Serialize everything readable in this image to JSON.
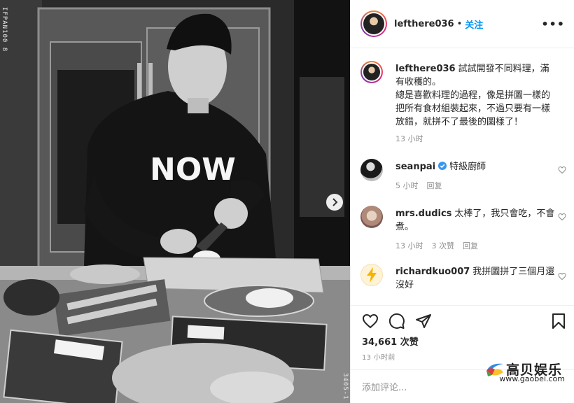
{
  "film": {
    "left_code": "IFPAN100   8",
    "right_code": "3405-1"
  },
  "shirt_text": "NOW",
  "post": {
    "username": "lefthere036",
    "separator": "•",
    "follow_label": "关注",
    "more_icon": "more-horizontal-icon"
  },
  "caption": {
    "username": "lefthere036",
    "text": "試試開發不同料理，滿有收穫的。",
    "line2": "總是喜歡料理的過程，像是拼圖一樣的把所有食材組裝起來，不過只要有一樣放錯，就拼不了最後的圖樣了！",
    "time": "13 小时"
  },
  "comments": [
    {
      "username": "seanpai",
      "verified": true,
      "text": "特級廚師",
      "time": "5 小时",
      "reply": "回复"
    },
    {
      "username": "mrs.dudics",
      "verified": false,
      "text": "太棒了，我只會吃，不會煮。",
      "time": "13 小时",
      "likes": "3 次赞",
      "reply": "回复"
    },
    {
      "username": "richardkuo007",
      "verified": false,
      "text": "我拼圖拼了三個月還沒好"
    }
  ],
  "actions": {
    "like_icon": "heart-icon",
    "comment_icon": "comment-icon",
    "share_icon": "share-icon",
    "save_icon": "bookmark-icon",
    "likes": "34,661 次赞",
    "time": "13 小时前"
  },
  "add_comment": {
    "placeholder": "添加评论..."
  },
  "watermark": {
    "name": "高贝娱乐",
    "url": "www.gaobei.com"
  },
  "colors": {
    "link": "#0095f6",
    "meta": "#8e8e8e",
    "border": "#efefef"
  }
}
